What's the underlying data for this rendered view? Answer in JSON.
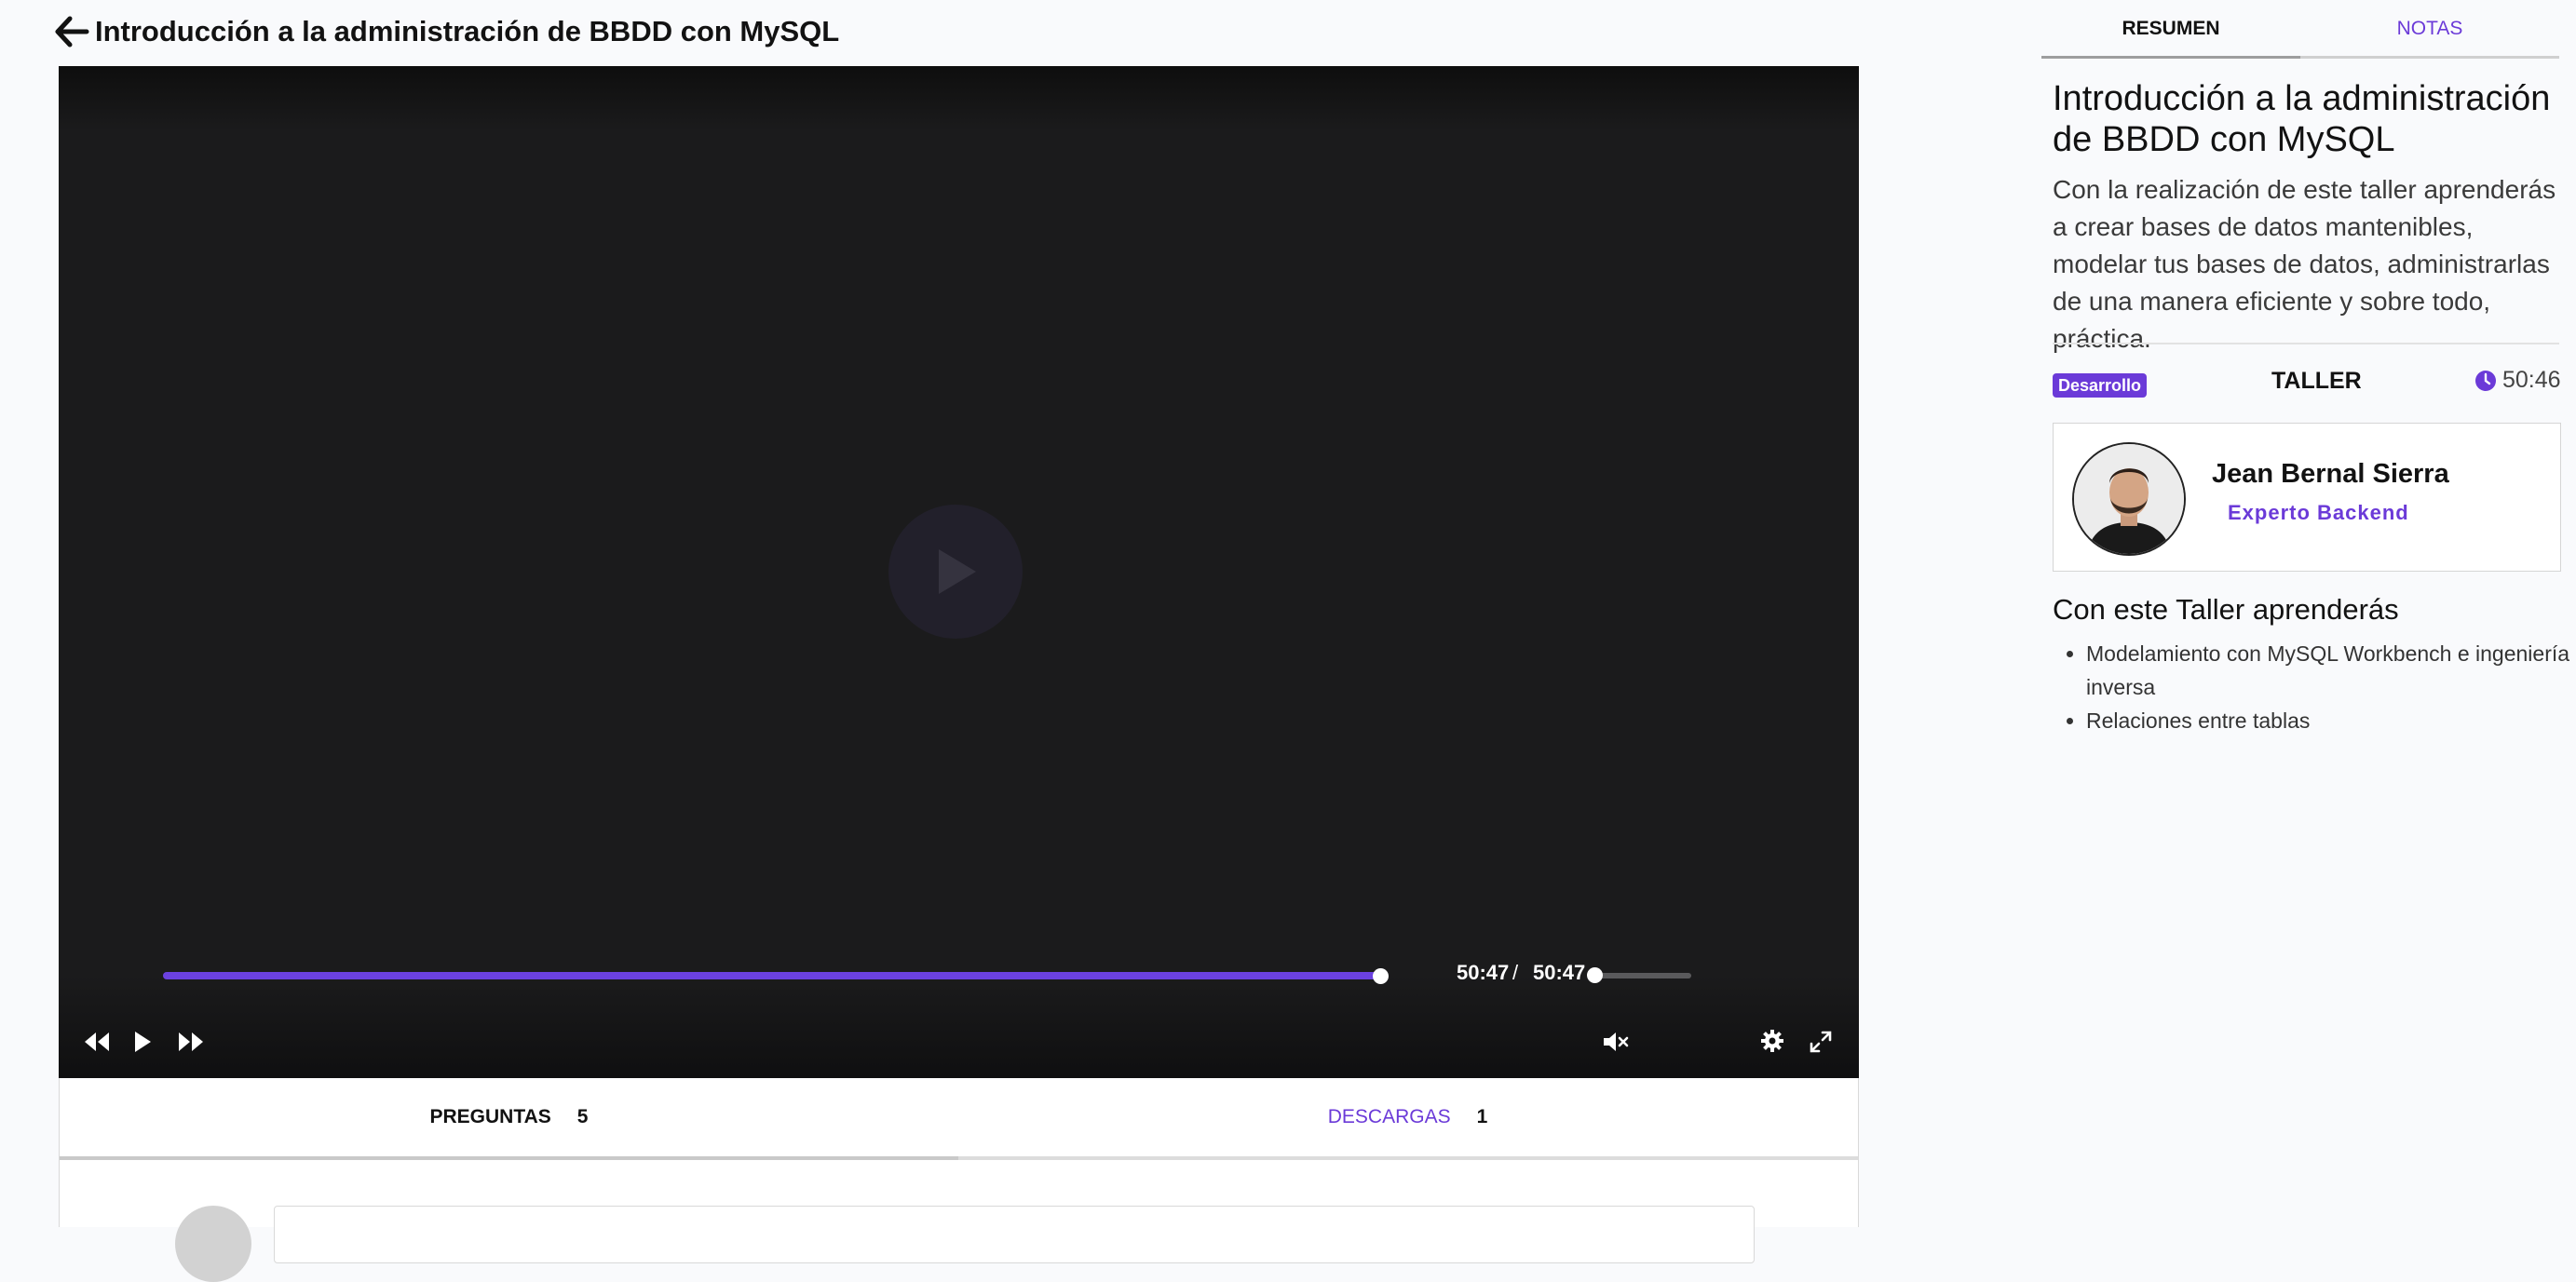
{
  "header": {
    "title": "Introducción a la administración de BBDD con MySQL"
  },
  "player": {
    "current_time": "50:47",
    "separator": "/",
    "total_time": "50:47",
    "progress": 1.0,
    "volume": 0.0,
    "muted": true,
    "accent_color": "#6b41e0",
    "icons": [
      "rewind-icon",
      "play-icon",
      "fast-forward-icon",
      "mute-icon",
      "settings-icon",
      "fullscreen-icon"
    ]
  },
  "lower_tabs": [
    {
      "label": "PREGUNTAS",
      "count": "5",
      "active": true
    },
    {
      "label": "DESCARGAS",
      "count": "1",
      "active": false
    }
  ],
  "right_tabs": [
    {
      "label": "RESUMEN",
      "active": true
    },
    {
      "label": "NOTAS",
      "active": false
    }
  ],
  "course": {
    "title": "Introducción a la administración de BBDD con MySQL",
    "description": "Con la realización de este taller aprenderás a crear bases de datos mantenibles, modelar tus bases de datos, administrarlas de una manera eficiente y sobre todo, práctica.",
    "category_badge": "Desarrollo",
    "type": "TALLER",
    "duration": "50:46",
    "badge_color": "#6b3ad8"
  },
  "instructor": {
    "name": "Jean Bernal Sierra",
    "role": "Experto Backend"
  },
  "learn": {
    "title": "Con este Taller aprenderás",
    "items": [
      "Modelamiento con MySQL Workbench e ingeniería inversa",
      "Relaciones entre tablas"
    ]
  }
}
